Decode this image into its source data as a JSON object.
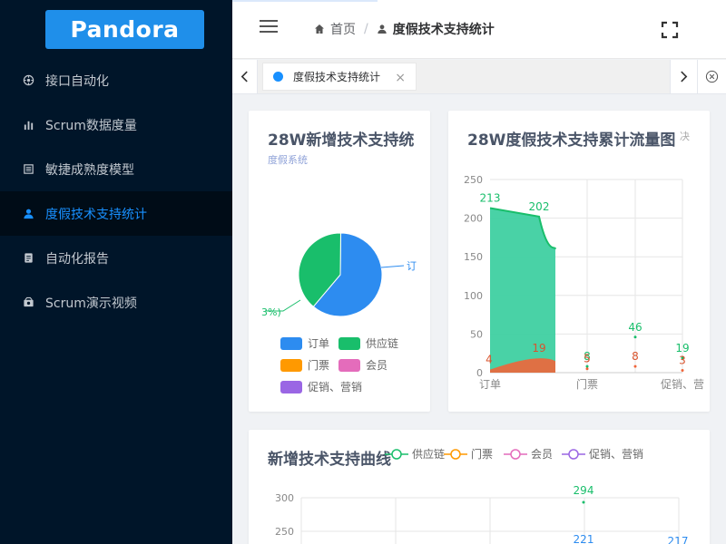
{
  "app": {
    "logo": "Pandora"
  },
  "sidebar": {
    "items": [
      {
        "label": "接口自动化",
        "icon": "api-icon"
      },
      {
        "label": "Scrum数据度量",
        "icon": "bar-chart-icon"
      },
      {
        "label": "敏捷成熟度模型",
        "icon": "model-icon"
      },
      {
        "label": "度假技术支持统计",
        "icon": "user-icon",
        "active": true
      },
      {
        "label": "自动化报告",
        "icon": "report-icon"
      },
      {
        "label": "Scrum演示视频",
        "icon": "video-icon"
      }
    ]
  },
  "header": {
    "breadcrumb_home": "首页",
    "breadcrumb_current": "度假技术支持统计"
  },
  "tabs": {
    "active_label": "度假技术支持统计",
    "close_glyph": "×"
  },
  "colors": {
    "blue": "#2d8cf0",
    "green": "#19be6b",
    "orange": "#ff9900",
    "pink": "#e46cbb",
    "purple": "#9a66e4",
    "area_green": "#3fd0a1",
    "area_red": "#f0653a"
  },
  "pie_card": {
    "title": "28W新增技术支持统",
    "subtitle": "度假系统",
    "label_right": "订",
    "label_left": "3%)",
    "legend": [
      "订单",
      "供应链",
      "门票",
      "会员",
      "促销、营销"
    ]
  },
  "chart_data": [
    {
      "type": "pie",
      "title": "28W新增技术支持统",
      "categories": [
        "订单",
        "供应链",
        "门票",
        "会员",
        "促销、营销"
      ],
      "values": [
        61,
        39,
        0,
        0,
        0
      ]
    },
    {
      "type": "area",
      "title": "28W度假技术支持累计流量图",
      "legend_fragment": "决",
      "categories": [
        "订单",
        "门票",
        "促销、营"
      ],
      "ylim": [
        0,
        250
      ],
      "yticks": [
        0,
        50,
        100,
        150,
        200,
        250
      ],
      "series": [
        {
          "values": [
            213,
            202,
            8,
            46,
            19
          ]
        },
        {
          "values": [
            4,
            19,
            5,
            8,
            3
          ]
        }
      ]
    },
    {
      "type": "line",
      "title": "新增技术支持曲线",
      "legend": [
        "供应链",
        "门票",
        "会员",
        "促销、营销"
      ],
      "yticks": [
        250,
        300
      ],
      "labels": [
        "294",
        "221",
        "217"
      ]
    }
  ]
}
